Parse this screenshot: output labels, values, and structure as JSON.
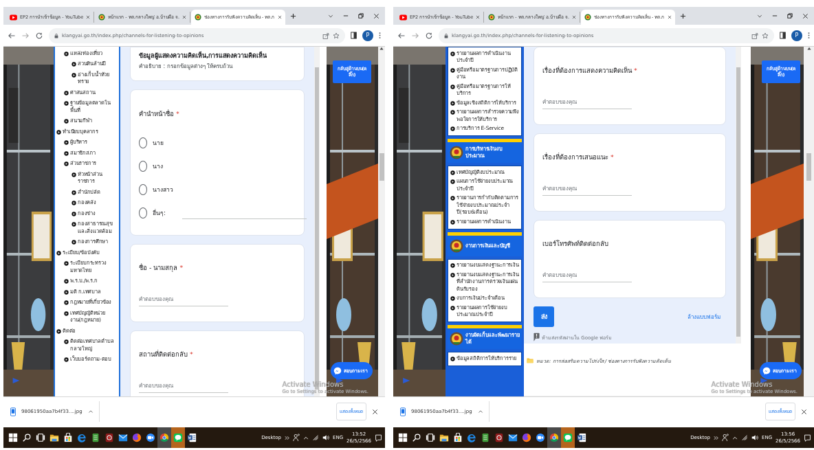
{
  "screens": [
    {
      "tabs": [
        {
          "label": "EP2 การนำเข้าข้อมูล - YouTube",
          "selected": false
        },
        {
          "label": "หน้าแรก - ทต.กลางใหญ่ อ.บ้านผือ จ.",
          "selected": false
        },
        {
          "label": "ช่องทางการรับฟังความคิดเห็น - ทต.ก",
          "selected": true
        }
      ],
      "address": "klangyai.go.th/index.php/channels-for-listening-to-opinions",
      "profile": "P",
      "sidebar": {
        "kind": "tree",
        "partial_items": [
          {
            "label": "แหล่งท่องเที่ยว",
            "children": [
              {
                "label": "สวนหินล้านปี"
              },
              {
                "label": "อ่างเก็บน้ำห้วยทราย"
              }
            ]
          },
          {
            "label": "ศาสนสถาน"
          },
          {
            "label": "ฐานข้อมูลตลาดในพื้นที่"
          },
          {
            "label": "สนามกีฬา"
          }
        ],
        "items": [
          {
            "label": "ทำเนียบบุคลากร",
            "children": [
              {
                "label": "ผู้บริหาร"
              },
              {
                "label": "สมาชิกสภา"
              },
              {
                "label": "ส่วนราชการ",
                "children": [
                  {
                    "label": "หัวหน้าส่วนราชการ"
                  },
                  {
                    "label": "สำนักปลัด"
                  },
                  {
                    "label": "กองคลัง"
                  },
                  {
                    "label": "กองช่าง"
                  },
                  {
                    "label": "กองสาธารณสุขและสิ่งแวดล้อม"
                  },
                  {
                    "label": "กองการศึกษา"
                  }
                ]
              }
            ]
          },
          {
            "label": "ระเบียบ/ข้อบังคับ",
            "children": [
              {
                "label": "ระเบียบกระทรวงมหาดไทย"
              },
              {
                "label": "พ.ร.บ./พ.ร.ก"
              },
              {
                "label": "มติ ก.เทศบาล"
              },
              {
                "label": "กฎหมายที่เกี่ยวข้อง"
              },
              {
                "label": "เทศบัญญัติหน่วยงาน(กฎหมาย)"
              }
            ]
          },
          {
            "label": "ติดต่อ",
            "children": [
              {
                "label": "ติดต่อเทศบาลตำบลกลางใหญ่"
              },
              {
                "label": "เว็บบอร์ดถาม-ตอบ"
              }
            ]
          }
        ]
      },
      "form": {
        "cards": [
          {
            "kind": "header",
            "title": "ข้อมูลผู้แสดงความคิดเห็น,การแสดงความคิดเห็น",
            "description": "คำอธิบาย : กรอกข้อมูลต่างๆ ให้ครบถ้วน"
          },
          {
            "kind": "choice",
            "question": "คำนำหน้าชื่อ",
            "required_mark": "*",
            "options": [
              {
                "label": "นาย",
                "selected": false
              },
              {
                "label": "นาง",
                "selected": false
              },
              {
                "label": "นางสาว",
                "selected": false
              },
              {
                "label": "อื่นๆ:",
                "selected": false,
                "other": true
              }
            ]
          },
          {
            "kind": "text",
            "question": "ชื่อ - นามสกุล",
            "required_mark": "*",
            "placeholder": "คำตอบของคุณ"
          },
          {
            "kind": "text",
            "question": "สถานที่ติดต่อกลับ",
            "required_mark": "*",
            "placeholder": "คำตอบของคุณ"
          }
        ]
      },
      "back_to_top": "กลับสู่ด้านบน(คลิ๊ก)",
      "chat": "สอบถามเรา",
      "activation": [
        "Activate Windows",
        "Go to Settings to activate Windows."
      ],
      "download": {
        "file": "98061950aa7b4f33....jpg",
        "show_all": "แสดงทั้งหมด"
      },
      "taskbar": {
        "desktop": "Desktop",
        "language": "ENG",
        "time": "13:52",
        "date": "26/5/2566"
      }
    },
    {
      "tabs": [
        {
          "label": "EP2 การนำเข้าข้อมูล - YouTube",
          "selected": false
        },
        {
          "label": "หน้าแรก - ทต.กลางใหญ่ อ.บ้านผือ จ.",
          "selected": false
        },
        {
          "label": "ช่องทางการรับฟังความคิดเห็น - ทต.ก",
          "selected": true
        }
      ],
      "address": "klangyai.go.th/index.php/channels-for-listening-to-opinions",
      "profile": "P",
      "sidebar": {
        "kind": "sections",
        "lead_items": [
          {
            "label": "รายงานผลการดำเนินงานประจำปี"
          },
          {
            "label": "คู่มือหรือมาตรฐานการปฏิบัติงาน"
          },
          {
            "label": "คู่มือหรือมาตรฐานการให้บริการ"
          },
          {
            "label": "ข้อมูลเชิงสถิติการให้บริการ"
          },
          {
            "label": "รายงานผลการสำรวจความพึงพอใจการให้บริการ"
          },
          {
            "label": "การบริการ E-Service"
          }
        ],
        "sections": [
          {
            "title": "การบริหารเงินงบประมาณ",
            "items": [
              {
                "label": "เทศบัญญัติงบประมาณ"
              },
              {
                "label": "แผนการใช้จ่ายงบประมาณประจำปี"
              },
              {
                "label": "รายงานการกำกับติดตามการใช้จ่ายงบประมาณประจำปี(รอบ6เดือน)"
              },
              {
                "label": "รายงานผลการดำเนินงาน"
              }
            ]
          },
          {
            "title": "งานการเงินและบัญชี",
            "items": [
              {
                "label": "รายงานงบแสดงฐานะการเงิน"
              },
              {
                "label": "รายงานงบแสดงฐานะการเงินที่สำนักงานการตรวจเงินแผ่นดินรับรอง"
              },
              {
                "label": "งบการเงินประจำเดือน"
              },
              {
                "label": "รายงานผลการใช้จ่ายงบประมาณประจำปี"
              }
            ]
          },
          {
            "title": "งานจัดเก็บและพัฒนารายได้",
            "items": [
              {
                "label": "ข้อมูลสถิติการให้บริการราย"
              }
            ]
          }
        ]
      },
      "form": {
        "cards": [
          {
            "kind": "text",
            "question": "เรื่องที่ต้องการแสดงความคิดเห็น",
            "required_mark": "*",
            "placeholder": "คำตอบของคุณ"
          },
          {
            "kind": "text",
            "question": "เรื่องที่ต้องการเสนอแนะ",
            "required_mark": "*",
            "placeholder": "คำตอบของคุณ"
          },
          {
            "kind": "text",
            "question": "เบอร์โทรศัพท์ติดต่อกลับ",
            "placeholder": "คำตอบของคุณ"
          }
        ],
        "submit": "ส่ง",
        "clear": "ล้างแบบฟอร์ม",
        "note": "ห้ามส่งรหัสผ่านใน Google ฟอร์ม",
        "category": "หมวด: การส่งเสริมความโปร่งใส / ช่องทางการรับฟังความคิดเห็น"
      },
      "back_to_top": "กลับสู่ด้านบน(คลิ๊ก)",
      "chat": "สอบถามเรา",
      "activation": [
        "Activate Windows",
        "Go to Settings to activate Windows."
      ],
      "download": {
        "file": "98061950aa7b4f33....jpg",
        "show_all": "แสดงทั้งหมด"
      },
      "taskbar": {
        "desktop": "Desktop",
        "language": "ENG",
        "time": "13:56",
        "date": "26/5/2566"
      }
    }
  ]
}
